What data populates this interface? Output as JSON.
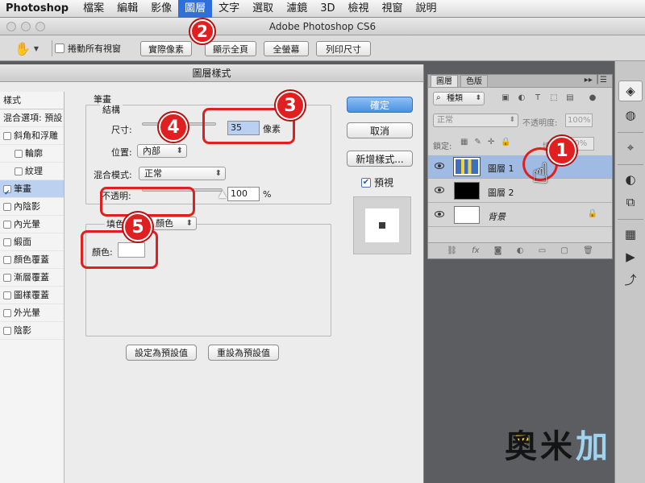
{
  "menubar": {
    "app": "Photoshop",
    "items": [
      "檔案",
      "編輯",
      "影像",
      "圖層",
      "文字",
      "選取",
      "濾鏡",
      "3D",
      "檢視",
      "視窗",
      "說明"
    ],
    "active_index": 3
  },
  "window": {
    "title": "Adobe Photoshop CS6"
  },
  "options_bar": {
    "scroll_all_label": "捲動所有視窗",
    "buttons": [
      "實際像素",
      "顯示全頁",
      "全螢幕",
      "列印尺寸"
    ]
  },
  "dialog": {
    "title": "圖層樣式",
    "styles_header": "樣式",
    "styles": [
      {
        "label": "混合選項: 預設",
        "checkbox": false,
        "checked": false,
        "indent": false,
        "selected": false
      },
      {
        "label": "斜角和浮雕",
        "checkbox": true,
        "checked": false,
        "indent": false,
        "selected": false
      },
      {
        "label": "輪廓",
        "checkbox": true,
        "checked": false,
        "indent": true,
        "selected": false
      },
      {
        "label": "紋理",
        "checkbox": true,
        "checked": false,
        "indent": true,
        "selected": false
      },
      {
        "label": "筆畫",
        "checkbox": true,
        "checked": true,
        "indent": false,
        "selected": true
      },
      {
        "label": "內陰影",
        "checkbox": true,
        "checked": false,
        "indent": false,
        "selected": false
      },
      {
        "label": "內光暈",
        "checkbox": true,
        "checked": false,
        "indent": false,
        "selected": false
      },
      {
        "label": "緞面",
        "checkbox": true,
        "checked": false,
        "indent": false,
        "selected": false
      },
      {
        "label": "顏色覆蓋",
        "checkbox": true,
        "checked": false,
        "indent": false,
        "selected": false
      },
      {
        "label": "漸層覆蓋",
        "checkbox": true,
        "checked": false,
        "indent": false,
        "selected": false
      },
      {
        "label": "圖樣覆蓋",
        "checkbox": true,
        "checked": false,
        "indent": false,
        "selected": false
      },
      {
        "label": "外光暈",
        "checkbox": true,
        "checked": false,
        "indent": false,
        "selected": false
      },
      {
        "label": "陰影",
        "checkbox": true,
        "checked": false,
        "indent": false,
        "selected": false
      }
    ],
    "stroke": {
      "group_label": "筆畫",
      "structure_label": "結構",
      "size_label": "尺寸:",
      "size_value": "35",
      "size_unit": "像素",
      "size_slider_fraction": 0.35,
      "position_label": "位置:",
      "position_value": "內部",
      "blend_mode_label": "混合模式:",
      "blend_mode_value": "正常",
      "opacity_label": "不透明:",
      "opacity_value": "100",
      "opacity_unit": "%",
      "opacity_slider_fraction": 1.0,
      "fill_type_label": "填色",
      "fill_type_value": "顏色",
      "color_label": "顏色:",
      "color_value": "#ffffff"
    },
    "buttons": {
      "ok": "確定",
      "cancel": "取消",
      "new_style": "新增樣式...",
      "preview_label": "預視",
      "preview_checked": true,
      "make_default": "設定為預設值",
      "reset_default": "重設為預設值"
    }
  },
  "layers_panel": {
    "tabs": [
      "圖層",
      "色版"
    ],
    "active_tab": 0,
    "filter_value": "種類",
    "blend_mode": "正常",
    "opacity_label": "不透明度:",
    "opacity_value": "100%",
    "lock_label": "鎖定:",
    "fill_label": "填",
    "fill_value": "00%",
    "layers": [
      {
        "name": "圖層 1",
        "selected": true,
        "thumb": "image",
        "locked": false
      },
      {
        "name": "圖層 2",
        "selected": false,
        "thumb": "black",
        "locked": false
      },
      {
        "name": "背景",
        "selected": false,
        "thumb": "white",
        "locked": true
      }
    ]
  },
  "annotations": [
    {
      "number": "1",
      "target": "圖層 1"
    },
    {
      "number": "2",
      "target": "圖層 menu"
    },
    {
      "number": "3",
      "target": "尺寸"
    },
    {
      "number": "4",
      "target": "位置"
    },
    {
      "number": "5",
      "target": "顏色"
    }
  ],
  "watermark": {
    "text": "奧米加"
  },
  "colors": {
    "accent": "#2f6fd9",
    "callout": "#e02020",
    "selected_layer": "#9fbbe3",
    "selected_style": "#bcd1ef"
  }
}
